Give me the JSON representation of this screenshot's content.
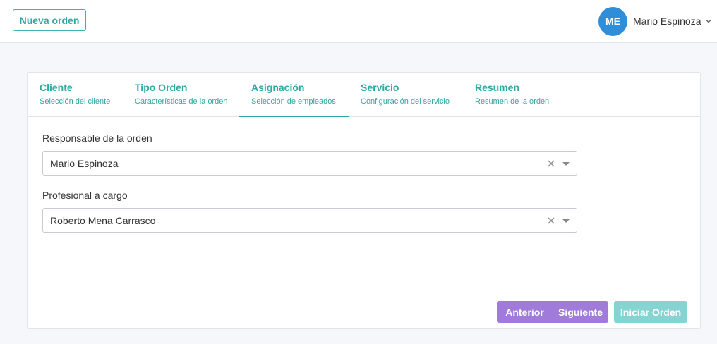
{
  "header": {
    "new_order_label": "Nueva orden",
    "user": {
      "initials": "ME",
      "name": "Mario Espinoza"
    }
  },
  "tabs": [
    {
      "title": "Cliente",
      "subtitle": "Selección del cliente"
    },
    {
      "title": "Tipo Orden",
      "subtitle": "Características de la orden"
    },
    {
      "title": "Asignación",
      "subtitle": "Selección de empleados"
    },
    {
      "title": "Servicio",
      "subtitle": "Configuración del servicio"
    },
    {
      "title": "Resumen",
      "subtitle": "Resumen de la orden"
    }
  ],
  "active_tab": "Asignación",
  "form": {
    "responsable": {
      "label": "Responsable de la orden",
      "value": "Mario Espinoza"
    },
    "profesional": {
      "label": "Profesional a cargo",
      "value": "Roberto Mena Carrasco"
    }
  },
  "footer": {
    "prev_label": "Anterior",
    "next_label": "Siguiente",
    "start_label": "Iniciar Orden"
  },
  "colors": {
    "accent": "#2fa9a3",
    "avatar": "#2f8ed9",
    "nav_buttons": "#a17bd9",
    "start_button": "#86d4d2"
  },
  "icons": {
    "user_menu": "chevron-down-icon",
    "select_clear": "close-icon",
    "select_arrow": "caret-down-icon"
  }
}
